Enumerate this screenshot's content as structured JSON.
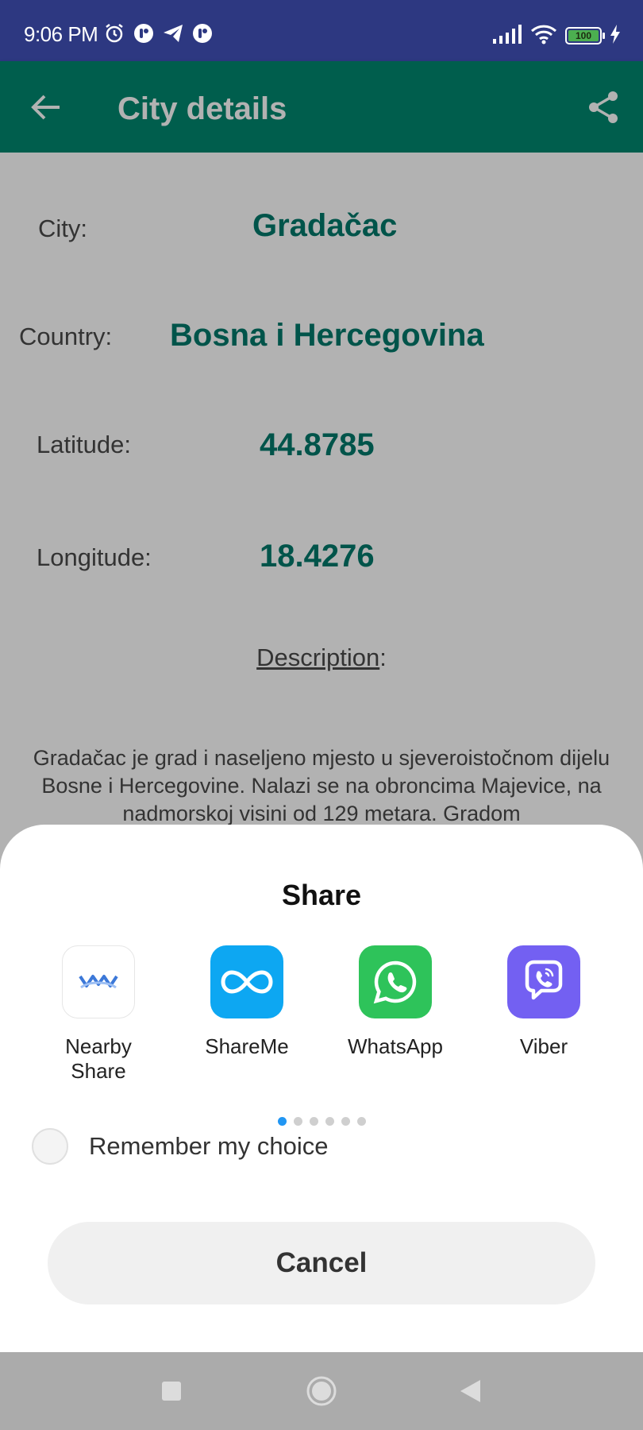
{
  "status_bar": {
    "time": "9:06 PM",
    "battery": "100",
    "icons_left": [
      "alarm-icon",
      "app-notification-icon",
      "telegram-icon",
      "app-notification-icon"
    ],
    "icons_right": [
      "signal-icon",
      "wifi-icon",
      "battery-icon",
      "charging-icon"
    ]
  },
  "app_bar": {
    "title": "City details",
    "back_icon": "arrow-left-icon",
    "share_icon": "share-icon",
    "color": "#00876f"
  },
  "details": {
    "city_label": "City:",
    "city_value": "Gradačac",
    "country_label": "Country:",
    "country_value": "Bosna i Hercegovina",
    "latitude_label": "Latitude:",
    "latitude_value": "44.8785",
    "longitude_label": "Longitude:",
    "longitude_value": "18.4276",
    "description_heading": "Description",
    "description_colon": ":",
    "description_text": "Gradačac je grad i naseljeno mjesto u sjeveroistočnom dijelu Bosne i Hercegovine. Nalazi se na obroncima Majevice, na nadmorskoj visini od 129 metara. Gradom"
  },
  "share_sheet": {
    "title": "Share",
    "apps": [
      {
        "label_line1": "Nearby",
        "label_line2": "Share",
        "icon": "nearby-share-icon"
      },
      {
        "label_line1": "ShareMe",
        "label_line2": "",
        "icon": "shareme-icon"
      },
      {
        "label_line1": "WhatsApp",
        "label_line2": "",
        "icon": "whatsapp-icon"
      },
      {
        "label_line1": "Viber",
        "label_line2": "",
        "icon": "viber-icon"
      }
    ],
    "page_count": 6,
    "active_page": 1,
    "remember_label": "Remember my choice",
    "cancel_label": "Cancel"
  },
  "nav_bar": {
    "icons": [
      "recents-icon",
      "home-icon",
      "back-icon"
    ]
  }
}
